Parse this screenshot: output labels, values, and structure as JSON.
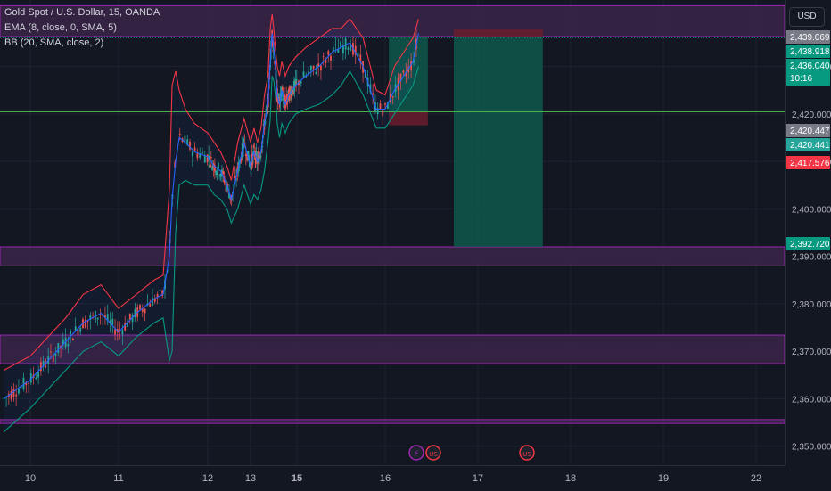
{
  "header": {
    "symbol": "Gold Spot / U.S. Dollar, 15, OANDA",
    "ema": "EMA (8, close, 0, SMA, 5)",
    "bb": "BB (20, SMA, close, 2)",
    "currency": "USD"
  },
  "colors": {
    "background": "#131722",
    "zone_fill": "#3b2448",
    "zone_border": "#9c27b0",
    "ema_line": "#2962ff",
    "bb_upper": "#f23645",
    "bb_lower": "#089981",
    "bb_basis": "#2962ff",
    "bull_candle": "#26a69a",
    "bear_candle": "#ef5350",
    "profit_box": "#0e5c4e",
    "loss_box": "#6b1d2e",
    "green_line": "#4caf50"
  },
  "badges": [
    {
      "value": "2,439.069",
      "color": "#787b86"
    },
    {
      "value": "2,438.918",
      "color": "#089981"
    },
    {
      "value": "2,436.040",
      "sub": "10:16",
      "color": "#089981"
    },
    {
      "value": "2,420.447",
      "color": "#787b86"
    },
    {
      "value": "2,420.441",
      "color": "#26a69a"
    },
    {
      "value": "2,417.576",
      "color": "#f23645"
    },
    {
      "value": "2,392.720",
      "color": "#089981"
    }
  ],
  "events": [
    {
      "name": "lightning-event-icon",
      "symbol": "⚡",
      "color": "#9c27b0"
    },
    {
      "name": "flag-event-icon",
      "symbol": "US",
      "color": "#f23645"
    },
    {
      "name": "flag-event-icon-2",
      "symbol": "US",
      "color": "#f23645"
    }
  ],
  "chart_data": {
    "type": "candlestick",
    "title": "Gold Spot / U.S. Dollar, 15, OANDA",
    "x_ticks": [
      "10",
      "11",
      "12",
      "13",
      "15",
      "16",
      "17",
      "18",
      "19",
      "22"
    ],
    "y_ticks": [
      2350,
      2360,
      2370,
      2380,
      2390,
      2400,
      2410,
      2420,
      2430
    ],
    "y_tick_labels": [
      "2,350.000",
      "2,360.000",
      "2,370.000",
      "2,380.000",
      "2,390.000",
      "2,400.000",
      "2,410.000",
      "2,420.000",
      "2,430.000"
    ],
    "ylim": [
      2346,
      2444
    ],
    "horizontal_zones": [
      {
        "from": 2436.3,
        "to": 2442.8
      },
      {
        "from": 2388.0,
        "to": 2392.0
      },
      {
        "from": 2367.4,
        "to": 2373.4
      },
      {
        "from": 2354.8,
        "to": 2355.6
      }
    ],
    "horizontal_lines": [
      {
        "price": 2420.447,
        "color": "#4caf50"
      }
    ],
    "position_tools": [
      {
        "x_from": 16.04,
        "x_to": 16.46,
        "target": 2436.3,
        "entry": 2420.4,
        "stop": 2417.6
      },
      {
        "x_from": 16.74,
        "x_to": 17.7,
        "target": 2392.0,
        "entry": 2436.2,
        "stop": 2437.9
      }
    ],
    "series": [
      {
        "name": "EMA",
        "x": [
          9.7,
          10.0,
          10.2,
          10.4,
          10.6,
          10.8,
          11.0,
          11.2,
          11.4,
          11.5,
          11.57,
          11.6,
          11.64,
          11.68,
          11.75,
          11.85,
          12.0,
          12.15,
          12.3,
          12.45,
          12.55,
          12.7,
          12.85,
          13.0,
          13.15,
          13.3,
          13.45,
          13.6,
          13.75,
          13.85,
          13.93,
          14.0,
          14.07,
          14.15,
          14.25,
          14.35,
          14.5,
          14.65,
          14.8,
          14.95,
          15.1,
          15.25,
          15.4,
          15.5,
          15.6,
          15.75,
          15.9,
          16.0,
          16.1,
          16.2,
          16.3,
          16.36
        ],
        "y": [
          2360,
          2364,
          2368,
          2372,
          2376,
          2378,
          2374,
          2378,
          2381,
          2382,
          2390,
          2402,
          2410,
          2415,
          2414,
          2412,
          2411,
          2409,
          2408,
          2405,
          2402,
          2408,
          2414,
          2409,
          2412,
          2410,
          2412,
          2418,
          2422,
          2431,
          2437,
          2434,
          2430,
          2424,
          2422,
          2425,
          2422,
          2424,
          2425,
          2426,
          2428,
          2430,
          2433,
          2434,
          2435,
          2430,
          2421,
          2421,
          2425,
          2428,
          2431,
          2437
        ]
      },
      {
        "name": "BB Upper",
        "x": [
          9.7,
          10.0,
          10.2,
          10.4,
          10.6,
          10.8,
          11.0,
          11.2,
          11.4,
          11.5,
          11.57,
          11.6,
          11.64,
          11.68,
          11.75,
          11.85,
          12.0,
          12.15,
          12.3,
          12.45,
          12.55,
          12.7,
          12.85,
          13.0,
          13.15,
          13.3,
          13.45,
          13.6,
          13.75,
          13.85,
          13.93,
          14.0,
          14.07,
          14.15,
          14.25,
          14.35,
          14.5,
          14.65,
          14.8,
          14.95,
          15.1,
          15.25,
          15.4,
          15.5,
          15.6,
          15.75,
          15.9,
          16.0,
          16.1,
          16.2,
          16.3,
          16.36
        ],
        "y": [
          2366,
          2369,
          2373,
          2377,
          2382,
          2384,
          2379,
          2382,
          2385,
          2386,
          2404,
          2426,
          2429,
          2425,
          2421,
          2418,
          2416,
          2414,
          2412,
          2409,
          2406,
          2414,
          2419,
          2414,
          2417,
          2414,
          2417,
          2424,
          2428,
          2438,
          2441,
          2438,
          2434,
          2430,
          2428,
          2431,
          2428,
          2430,
          2431,
          2432,
          2434,
          2436,
          2438,
          2438,
          2440,
          2436,
          2425,
          2424,
          2430,
          2433,
          2436,
          2440
        ]
      },
      {
        "name": "BB Lower",
        "x": [
          9.7,
          10.0,
          10.2,
          10.4,
          10.6,
          10.8,
          11.0,
          11.2,
          11.4,
          11.5,
          11.57,
          11.6,
          11.64,
          11.68,
          11.75,
          11.85,
          12.0,
          12.15,
          12.3,
          12.45,
          12.55,
          12.7,
          12.85,
          13.0,
          13.15,
          13.3,
          13.45,
          13.6,
          13.75,
          13.85,
          13.93,
          14.0,
          14.07,
          14.15,
          14.25,
          14.35,
          14.5,
          14.65,
          14.8,
          14.95,
          15.1,
          15.25,
          15.4,
          15.5,
          15.6,
          15.75,
          15.9,
          16.0,
          16.1,
          16.2,
          16.3,
          16.36
        ],
        "y": [
          2353,
          2358,
          2362,
          2366,
          2370,
          2372,
          2369,
          2373,
          2376,
          2377,
          2368,
          2370,
          2395,
          2405,
          2406,
          2405,
          2405,
          2403,
          2402,
          2400,
          2397,
          2400,
          2405,
          2401,
          2403,
          2402,
          2404,
          2408,
          2414,
          2419,
          2428,
          2427,
          2424,
          2418,
          2415,
          2418,
          2416,
          2418,
          2419,
          2420,
          2421,
          2422,
          2424,
          2426,
          2429,
          2424,
          2417,
          2417,
          2420,
          2423,
          2426,
          2430
        ]
      }
    ]
  }
}
